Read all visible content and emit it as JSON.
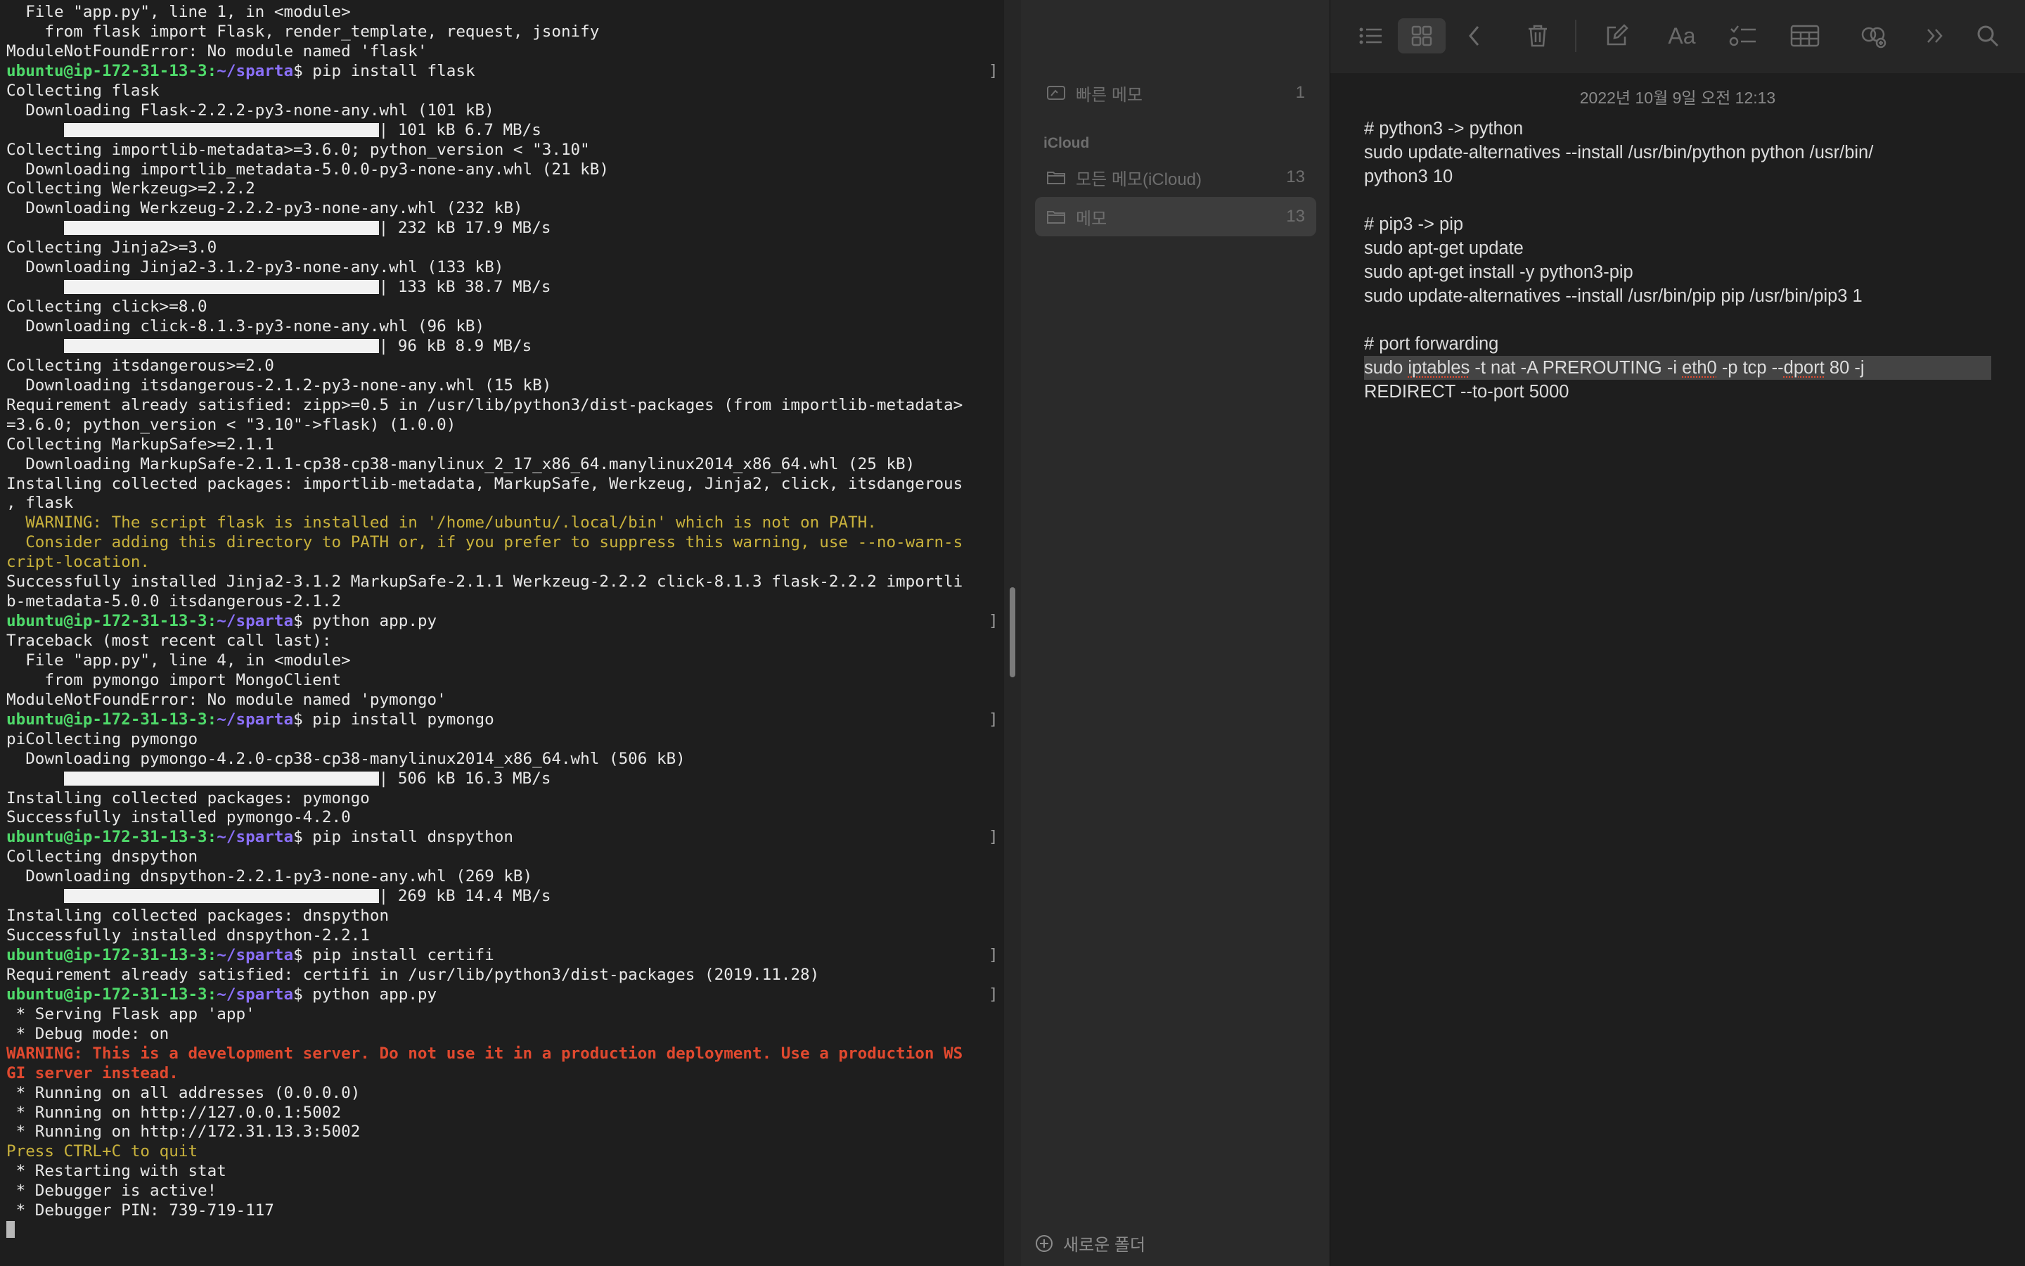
{
  "terminal": {
    "prompt_user": "ubuntu@ip-172-31-13-3",
    "prompt_path": "~/sparta",
    "lines": [
      {
        "type": "text",
        "text": "  File \"app.py\", line 1, in <module>"
      },
      {
        "type": "text",
        "text": "    from flask import Flask, render_template, request, jsonify"
      },
      {
        "type": "text",
        "text": "ModuleNotFoundError: No module named 'flask'"
      },
      {
        "type": "prompt",
        "cmd": "$ pip install flask"
      },
      {
        "type": "text",
        "text": "Collecting flask"
      },
      {
        "type": "text",
        "text": "  Downloading Flask-2.2.2-py3-none-any.whl (101 kB)"
      },
      {
        "type": "progress",
        "text": "| 101 kB 6.7 MB/s"
      },
      {
        "type": "text",
        "text": "Collecting importlib-metadata>=3.6.0; python_version < \"3.10\""
      },
      {
        "type": "text",
        "text": "  Downloading importlib_metadata-5.0.0-py3-none-any.whl (21 kB)"
      },
      {
        "type": "text",
        "text": "Collecting Werkzeug>=2.2.2"
      },
      {
        "type": "text",
        "text": "  Downloading Werkzeug-2.2.2-py3-none-any.whl (232 kB)"
      },
      {
        "type": "progress",
        "text": "| 232 kB 17.9 MB/s"
      },
      {
        "type": "text",
        "text": "Collecting Jinja2>=3.0"
      },
      {
        "type": "text",
        "text": "  Downloading Jinja2-3.1.2-py3-none-any.whl (133 kB)"
      },
      {
        "type": "progress",
        "text": "| 133 kB 38.7 MB/s"
      },
      {
        "type": "text",
        "text": "Collecting click>=8.0"
      },
      {
        "type": "text",
        "text": "  Downloading click-8.1.3-py3-none-any.whl (96 kB)"
      },
      {
        "type": "progress",
        "text": "| 96 kB 8.9 MB/s"
      },
      {
        "type": "text",
        "text": "Collecting itsdangerous>=2.0"
      },
      {
        "type": "text",
        "text": "  Downloading itsdangerous-2.1.2-py3-none-any.whl (15 kB)"
      },
      {
        "type": "text",
        "text": "Requirement already satisfied: zipp>=0.5 in /usr/lib/python3/dist-packages (from importlib-metadata>"
      },
      {
        "type": "text",
        "text": "=3.6.0; python_version < \"3.10\"->flask) (1.0.0)"
      },
      {
        "type": "text",
        "text": "Collecting MarkupSafe>=2.1.1"
      },
      {
        "type": "text",
        "text": "  Downloading MarkupSafe-2.1.1-cp38-cp38-manylinux_2_17_x86_64.manylinux2014_x86_64.whl (25 kB)"
      },
      {
        "type": "text",
        "text": "Installing collected packages: importlib-metadata, MarkupSafe, Werkzeug, Jinja2, click, itsdangerous"
      },
      {
        "type": "text",
        "text": ", flask"
      },
      {
        "type": "warn",
        "text": "  WARNING: The script flask is installed in '/home/ubuntu/.local/bin' which is not on PATH."
      },
      {
        "type": "warn",
        "text": "  Consider adding this directory to PATH or, if you prefer to suppress this warning, use --no-warn-s"
      },
      {
        "type": "warn",
        "text": "cript-location."
      },
      {
        "type": "text",
        "text": "Successfully installed Jinja2-3.1.2 MarkupSafe-2.1.1 Werkzeug-2.2.2 click-8.1.3 flask-2.2.2 importli"
      },
      {
        "type": "text",
        "text": "b-metadata-5.0.0 itsdangerous-2.1.2"
      },
      {
        "type": "prompt",
        "cmd": "$ python app.py"
      },
      {
        "type": "text",
        "text": "Traceback (most recent call last):"
      },
      {
        "type": "text",
        "text": "  File \"app.py\", line 4, in <module>"
      },
      {
        "type": "text",
        "text": "    from pymongo import MongoClient"
      },
      {
        "type": "text",
        "text": "ModuleNotFoundError: No module named 'pymongo'"
      },
      {
        "type": "prompt",
        "cmd": "$ pip install pymongo"
      },
      {
        "type": "text",
        "text": "piCollecting pymongo"
      },
      {
        "type": "text",
        "text": "  Downloading pymongo-4.2.0-cp38-cp38-manylinux2014_x86_64.whl (506 kB)"
      },
      {
        "type": "progress",
        "text": "| 506 kB 16.3 MB/s"
      },
      {
        "type": "text",
        "text": "Installing collected packages: pymongo"
      },
      {
        "type": "text",
        "text": "Successfully installed pymongo-4.2.0"
      },
      {
        "type": "prompt",
        "cmd": "$ pip install dnspython"
      },
      {
        "type": "text",
        "text": "Collecting dnspython"
      },
      {
        "type": "text",
        "text": "  Downloading dnspython-2.2.1-py3-none-any.whl (269 kB)"
      },
      {
        "type": "progress",
        "text": "| 269 kB 14.4 MB/s"
      },
      {
        "type": "text",
        "text": "Installing collected packages: dnspython"
      },
      {
        "type": "text",
        "text": "Successfully installed dnspython-2.2.1"
      },
      {
        "type": "prompt",
        "cmd": "$ pip install certifi"
      },
      {
        "type": "text",
        "text": "Requirement already satisfied: certifi in /usr/lib/python3/dist-packages (2019.11.28)"
      },
      {
        "type": "prompt",
        "cmd": "$ python app.py"
      },
      {
        "type": "text",
        "text": " * Serving Flask app 'app'"
      },
      {
        "type": "text",
        "text": " * Debug mode: on"
      },
      {
        "type": "err",
        "text": "WARNING: This is a development server. Do not use it in a production deployment. Use a production WS"
      },
      {
        "type": "err",
        "text": "GI server instead."
      },
      {
        "type": "text",
        "text": " * Running on all addresses (0.0.0.0)"
      },
      {
        "type": "text",
        "text": " * Running on http://127.0.0.1:5002"
      },
      {
        "type": "text",
        "text": " * Running on http://172.31.13.3:5002"
      },
      {
        "type": "yel",
        "text": "Press CTRL+C to quit"
      },
      {
        "type": "text",
        "text": " * Restarting with stat"
      },
      {
        "type": "text",
        "text": " * Debugger is active!"
      },
      {
        "type": "text",
        "text": " * Debugger PIN: 739-719-117"
      },
      {
        "type": "cursor",
        "text": ""
      }
    ],
    "prompt_bracket": "]"
  },
  "sidebar": {
    "quick_note": {
      "label": "빠른 메모",
      "count": "1"
    },
    "section_label": "iCloud",
    "folders": [
      {
        "label": "모든 메모(iCloud)",
        "count": "13"
      },
      {
        "label": "메모",
        "count": "13"
      }
    ],
    "new_folder_label": "새로운 폴더"
  },
  "editor": {
    "date": "2022년 10월 9일 오전 12:13",
    "note_lines": [
      "# python3 -> python",
      "sudo update-alternatives --install /usr/bin/python python /usr/bin/",
      "python3 10",
      "",
      "# pip3 -> pip",
      "sudo apt-get update",
      "sudo apt-get install -y python3-pip",
      "sudo update-alternatives --install /usr/bin/pip pip /usr/bin/pip3 1",
      "",
      "# port forwarding"
    ],
    "hl_line_1": {
      "pre": "sudo ",
      "word": "iptables",
      "mid": " -t nat -A PREROUTING -i ",
      "word2": "eth0",
      "mid2": " -p tcp --",
      "word3": "dport",
      "post": " 80 -j"
    },
    "hl_line_2": "REDIRECT --to-port 5000"
  }
}
